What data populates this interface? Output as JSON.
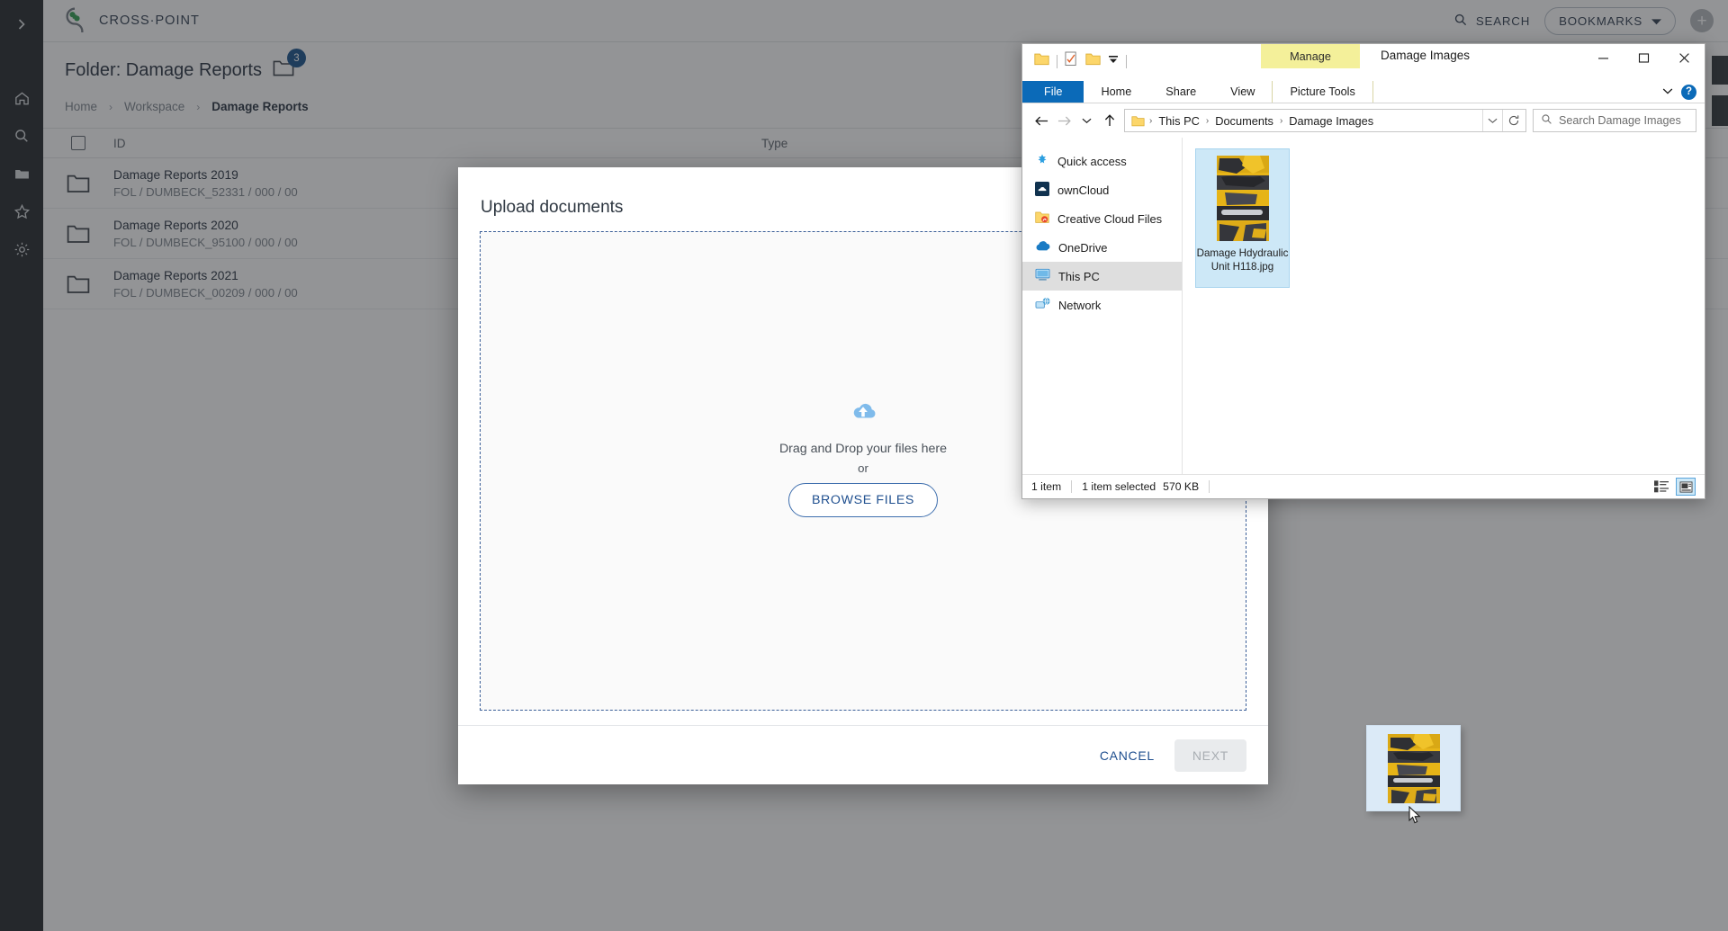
{
  "rail": {
    "icons": [
      {
        "name": "expand-chevron-icon",
        "label": "Expand"
      },
      {
        "name": "home-icon",
        "label": "Home"
      },
      {
        "name": "search-icon",
        "label": "Search"
      },
      {
        "name": "folder-icon",
        "label": "Folders"
      },
      {
        "name": "star-icon",
        "label": "Favorites"
      },
      {
        "name": "gear-icon",
        "label": "Settings"
      }
    ]
  },
  "header": {
    "brand": "CROSS·POINT",
    "search_label": "SEARCH",
    "bookmarks_label": "BOOKMARKS",
    "add_label": "+"
  },
  "page": {
    "title": "Folder: Damage Reports",
    "badge_count": "3",
    "breadcrumb": [
      "Home",
      "Workspace",
      "Damage Reports"
    ],
    "breadcrumb_sep": "›"
  },
  "table": {
    "columns": [
      "ID",
      "Type"
    ],
    "rows": [
      {
        "title": "Damage Reports 2019",
        "subtitle": "FOL / DUMBECK_52331 / 000 / 00",
        "type": ""
      },
      {
        "title": "Damage Reports 2020",
        "subtitle": "FOL / DUMBECK_95100 / 000 / 00",
        "type": ""
      },
      {
        "title": "Damage Reports 2021",
        "subtitle": "FOL / DUMBECK_00209 / 000 / 00",
        "type": ""
      }
    ]
  },
  "modal": {
    "title": "Upload documents",
    "drop_text": "Drag and Drop your files here",
    "or_text": "or",
    "browse_label": "BROWSE FILES",
    "cancel_label": "CANCEL",
    "next_label": "NEXT"
  },
  "explorer": {
    "title": "Damage Images",
    "context_tab_group": "Manage",
    "tabs": [
      "File",
      "Home",
      "Share",
      "View",
      "Picture Tools"
    ],
    "window_controls": {
      "minimize": "—",
      "maximize": "□",
      "close": "✕"
    },
    "help_label": "?",
    "address": {
      "crumbs": [
        "This PC",
        "Documents",
        "Damage Images"
      ],
      "separator": "›"
    },
    "search_placeholder": "Search Damage Images",
    "nav_items": [
      {
        "label": "Quick access",
        "icon": "star-pin-icon",
        "selected": false
      },
      {
        "label": "ownCloud",
        "icon": "owncloud-icon",
        "selected": false
      },
      {
        "label": "Creative Cloud Files",
        "icon": "creative-cloud-icon",
        "selected": false
      },
      {
        "label": "OneDrive",
        "icon": "onedrive-cloud-icon",
        "selected": false
      },
      {
        "label": "This PC",
        "icon": "monitor-icon",
        "selected": true
      },
      {
        "label": "Network",
        "icon": "network-icon",
        "selected": false
      }
    ],
    "files": [
      {
        "name": "Damage Hdydraulic Unit H118.jpg",
        "selected": true
      }
    ],
    "status": {
      "item_count": "1 item",
      "selection": "1 item selected",
      "size": "570 KB"
    }
  },
  "colors": {
    "accent_blue": "#17508a",
    "link_blue": "#1f4f8f",
    "explorer_blue": "#0b6ab8",
    "context_yellow": "#f4f09a",
    "selection_blue": "#cde8f7"
  }
}
